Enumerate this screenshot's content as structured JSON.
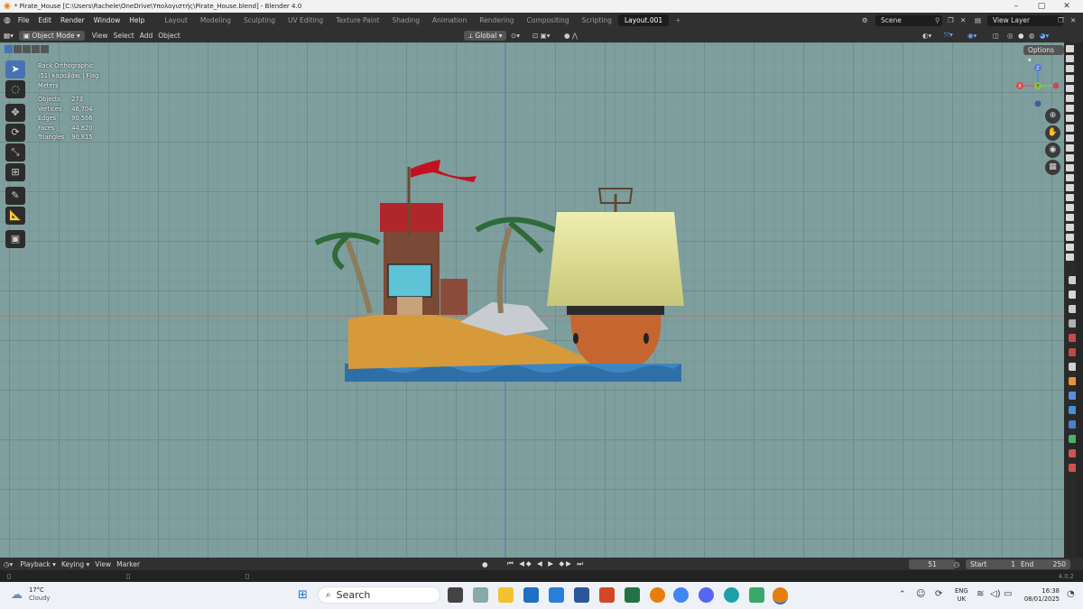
{
  "window": {
    "title": "* Pirate_House [C:\\Users\\Rachele\\OneDrive\\Υπολογιστής\\Pirate_House.blend] - Blender 4.0",
    "controls": [
      "minimize-icon",
      "maximize-icon",
      "close-icon"
    ]
  },
  "menu": [
    "File",
    "Edit",
    "Render",
    "Window",
    "Help"
  ],
  "workspaces": [
    "Layout",
    "Modeling",
    "Sculpting",
    "UV Editing",
    "Texture Paint",
    "Shading",
    "Animation",
    "Rendering",
    "Compositing",
    "Scripting",
    "Layout.001"
  ],
  "active_workspace": "Layout.001",
  "scene": "Scene",
  "view_layer": "View Layer",
  "viewport_header": {
    "mode": "Object Mode",
    "menus": [
      "View",
      "Select",
      "Add",
      "Object"
    ],
    "transform_orientation": "Global",
    "options": "Options"
  },
  "viewport": {
    "view_name": "Back Orthographic",
    "collection": "(51) καραβάκι | Flag",
    "units": "Meters",
    "stats": [
      {
        "label": "Objects",
        "value": "273"
      },
      {
        "label": "Vertices",
        "value": "46,704"
      },
      {
        "label": "Edges",
        "value": "90,566"
      },
      {
        "label": "Faces",
        "value": "44,820"
      },
      {
        "label": "Triangles",
        "value": "90,815"
      }
    ],
    "background_color": "#7f9e9e"
  },
  "gizmo_axes": [
    "Z",
    "Y",
    "X"
  ],
  "timeline": {
    "menus": [
      "Playback",
      "Keying",
      "View",
      "Marker"
    ],
    "current_frame": "51",
    "start_label": "Start",
    "start": "1",
    "end_label": "End",
    "end": "250"
  },
  "version": "4.0.2",
  "taskbar": {
    "weather_temp": "17°C",
    "weather_desc": "Cloudy",
    "search": "Search",
    "lang_top": "ENG",
    "lang_bottom": "UK",
    "time": "16:38",
    "date": "08/01/2025"
  },
  "colors": {
    "accent": "#4772b3",
    "flag": "#c3121f",
    "sail": "#e6e4a0",
    "sand": "#d69a3a",
    "water": "#2f6fa8"
  }
}
